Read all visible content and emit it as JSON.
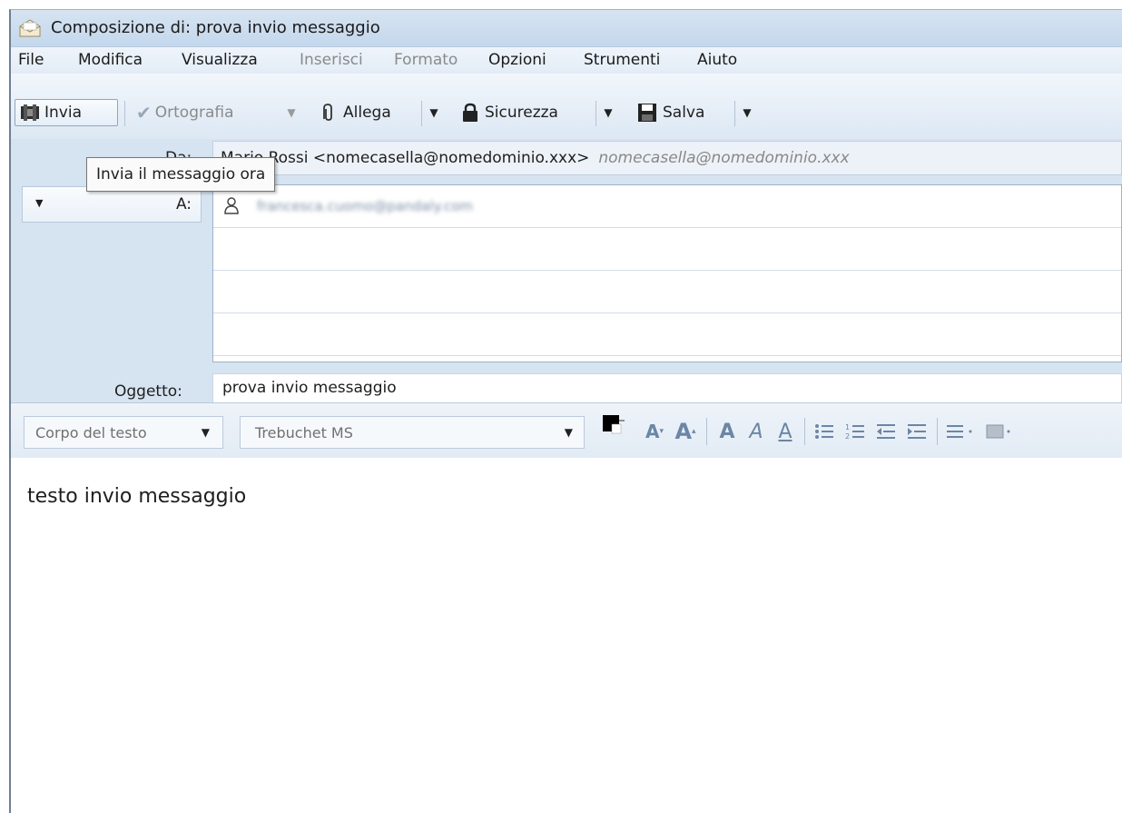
{
  "window": {
    "title": "Composizione di: prova invio messaggio"
  },
  "menu": {
    "items": [
      {
        "label": "File",
        "disabled": false
      },
      {
        "label": "Modifica",
        "disabled": false
      },
      {
        "label": "Visualizza",
        "disabled": false
      },
      {
        "label": "Inserisci",
        "disabled": true
      },
      {
        "label": "Formato",
        "disabled": true
      },
      {
        "label": "Opzioni",
        "disabled": false
      },
      {
        "label": "Strumenti",
        "disabled": false
      },
      {
        "label": "Aiuto",
        "disabled": false
      }
    ]
  },
  "toolbar": {
    "send_label": "Invia",
    "spelling_label": "Ortografia",
    "attach_label": "Allega",
    "security_label": "Sicurezza",
    "save_label": "Salva"
  },
  "tooltip": {
    "text": "Invia il messaggio ora"
  },
  "headers": {
    "from_label": "Da:",
    "from_value": "Mario Rossi <nomecasella@nomedominio.xxx>",
    "from_hint": "nomecasella@nomedominio.xxx",
    "to_label": "A:",
    "recipients": [
      "francesca.cuomo@pandaly.com",
      "",
      "",
      ""
    ],
    "subject_label": "Oggetto:",
    "subject_value": "prova invio messaggio"
  },
  "format": {
    "paragraph_style": "Corpo del testo",
    "font": "Trebuchet MS"
  },
  "body": {
    "text": "testo invio messaggio"
  },
  "colors": {
    "accent": "#d6e3f1",
    "tooltip_border": "#767676"
  }
}
